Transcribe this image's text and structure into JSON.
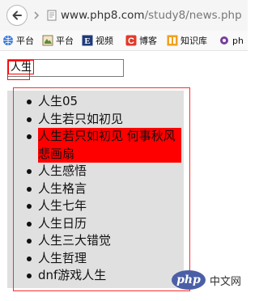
{
  "browser": {
    "url_host": "www.php8.com",
    "url_path": "/study8/news.php"
  },
  "bookmarks": [
    {
      "label": "平台",
      "icon": "globe-icon"
    },
    {
      "label": "平台",
      "icon": "bookmark-page-icon"
    },
    {
      "label": "视频",
      "icon": "e-logo-icon"
    },
    {
      "label": "博客",
      "icon": "c-logo-icon"
    },
    {
      "label": "知识库",
      "icon": "knowledge-base-icon"
    },
    {
      "label": "ph",
      "icon": "gear-icon"
    }
  ],
  "search": {
    "value": "人生"
  },
  "suggestions": [
    {
      "text": "人生05",
      "active": false
    },
    {
      "text": "人生若只如初见",
      "active": false
    },
    {
      "text": "人生若只如初见 何事秋风悲画扇",
      "active": true
    },
    {
      "text": "人生感悟",
      "active": false
    },
    {
      "text": "人生格言",
      "active": false
    },
    {
      "text": "人生七年",
      "active": false
    },
    {
      "text": "人生日历",
      "active": false
    },
    {
      "text": "人生三大错觉",
      "active": false
    },
    {
      "text": "人生哲理",
      "active": false
    },
    {
      "text": "dnf游戏人生",
      "active": false
    }
  ],
  "watermark": {
    "logo": "php",
    "text": "中文网"
  },
  "colors": {
    "highlight": "#ff0000",
    "list_bg": "#e0e0e0",
    "outline": "#ff2b2b"
  }
}
